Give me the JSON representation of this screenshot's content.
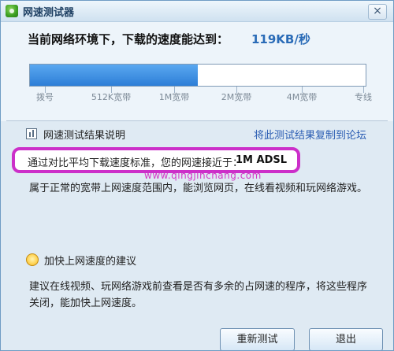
{
  "window": {
    "title": "网速测试器",
    "close_label": "×"
  },
  "speed": {
    "message": "当前网络环境下，下载的速度能达到：",
    "value": "119KB/秒",
    "progress_fraction": 0.5
  },
  "scale_labels": [
    "拨号",
    "512K宽带",
    "1M宽带",
    "2M宽带",
    "4M宽带",
    "专线"
  ],
  "results": {
    "section_title": "网速测试结果说明",
    "copy_link": "将此测试结果复制到论坛",
    "comparison_text": "通过对比平均下载速度标准，您的网速接近于：",
    "comparison_value": "1M ADSL",
    "description": "属于正常的宽带上网速度范围内，能浏览网页，在线看视频和玩网络游戏。",
    "watermark": "www.qingjinchang.com"
  },
  "advice": {
    "section_title": "加快上网速度的建议",
    "text": "建议在线视频、玩网络游戏前查看是否有多余的占网速的程序，将这些程序关闭，能加快上网速度。"
  },
  "buttons": {
    "retest": "重新测试",
    "exit": "退出"
  },
  "colors": {
    "window_bg": "#dfeaf3",
    "accent_blue": "#2a6bb7",
    "progress_blue": "#2d7ed7",
    "highlight_magenta": "#cc2fc9"
  },
  "icons": {
    "app": "network-test-icon",
    "chart": "chart-icon",
    "advice": "bulb-icon",
    "close": "close-icon"
  }
}
